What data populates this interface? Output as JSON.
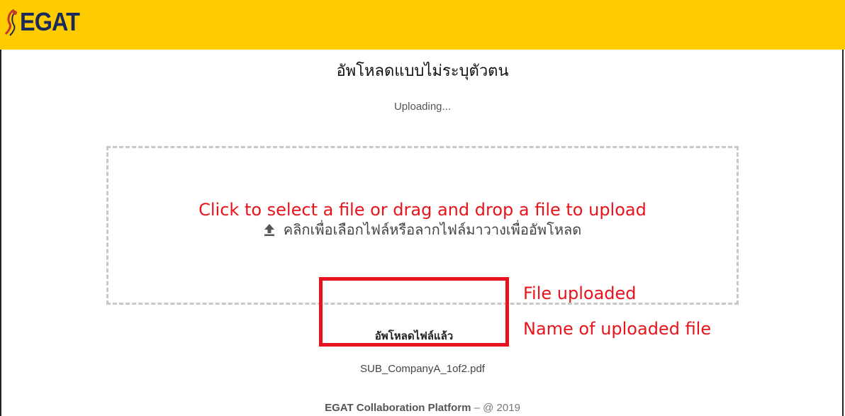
{
  "header": {
    "logo_text": "EGAT",
    "background_color": "#ffcc00",
    "logo_color": "#1a2a5a"
  },
  "page": {
    "title": "อัพโหลดแบบไม่ระบุตัวตน",
    "status": "Uploading..."
  },
  "dropzone": {
    "hint": "คลิกเพื่อเลือกไฟล์หรือลากไฟล์มาวางเพื่ออัพโหลด",
    "icon": "upload-icon"
  },
  "upload_result": {
    "label": "อัพโหลดไฟล์แล้ว",
    "file_name": "SUB_CompanyA_1of2.pdf"
  },
  "annotations": {
    "main": "Click to select a file or drag and drop a file to upload",
    "file_uploaded": "File uploaded",
    "file_name": "Name of uploaded file",
    "color": "#e8141b"
  },
  "footer": {
    "brand": "EGAT Collaboration Platform",
    "suffix": " – @ 2019"
  }
}
